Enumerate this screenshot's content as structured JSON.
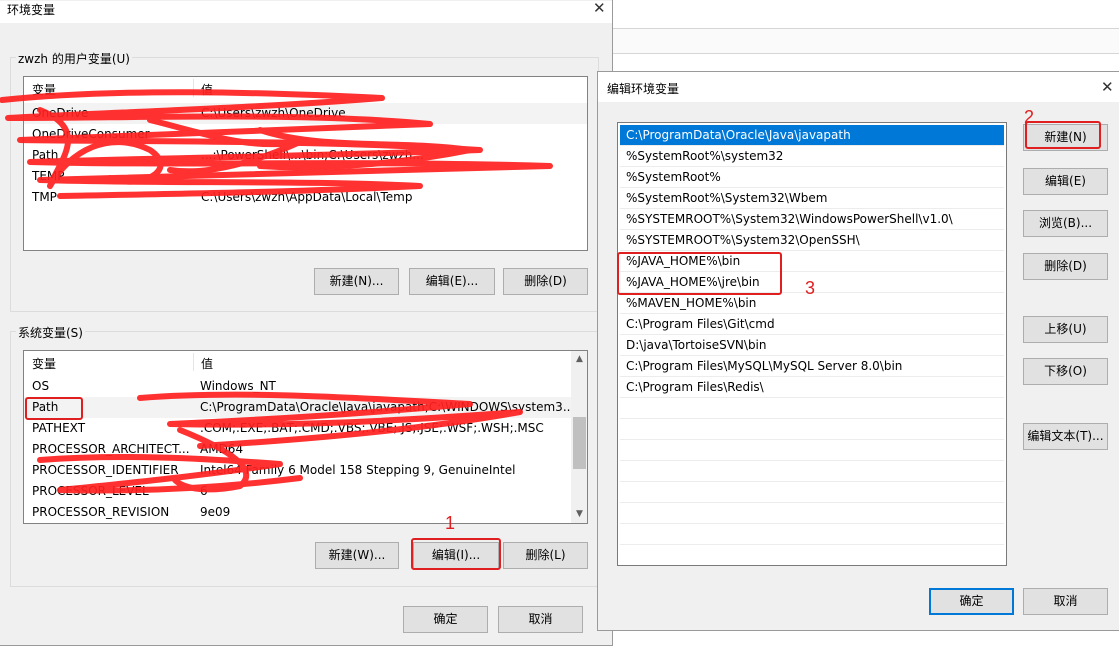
{
  "colors": {
    "accent": "#0078d7",
    "annotation_red": "#e02020",
    "window_bg": "#f0f0f0"
  },
  "env_dialog": {
    "title": "环境变量",
    "user_group_label": "zwzh 的用户变量(U)",
    "columns": {
      "variable": "变量",
      "value": "值"
    },
    "user_rows": [
      {
        "name": "OneDrive",
        "value": "C:\\Users\\zwzh\\OneDrive"
      },
      {
        "name": "OneDriveConsumer",
        "value": ""
      },
      {
        "name": "Path",
        "value": "...:\\PowerShell\\...\\bin;C:\\Users\\zwzh..."
      },
      {
        "name": "TEMP",
        "value": ""
      },
      {
        "name": "TMP",
        "value": "C:\\Users\\zwzh\\AppData\\Local\\Temp"
      }
    ],
    "user_buttons": {
      "new": "新建(N)...",
      "edit": "编辑(E)...",
      "delete": "删除(D)"
    },
    "system_group_label": "系统变量(S)",
    "system_rows": [
      {
        "name": "OS",
        "value": "Windows_NT"
      },
      {
        "name": "Path",
        "value": "C:\\ProgramData\\Oracle\\Java\\javapath;C:\\WINDOWS\\system3..."
      },
      {
        "name": "PATHEXT",
        "value": ".COM;.EXE;.BAT;.CMD;.VBS;.VBE;.JS;.JSE;.WSF;.WSH;.MSC"
      },
      {
        "name": "PROCESSOR_ARCHITECT...",
        "value": "AMD64"
      },
      {
        "name": "PROCESSOR_IDENTIFIER",
        "value": "Intel64 Family 6 Model 158 Stepping 9, GenuineIntel"
      },
      {
        "name": "PROCESSOR_LEVEL",
        "value": "6"
      },
      {
        "name": "PROCESSOR_REVISION",
        "value": "9e09"
      }
    ],
    "system_buttons": {
      "new": "新建(W)...",
      "edit": "编辑(I)...",
      "delete": "删除(L)"
    },
    "ok": "确定",
    "cancel": "取消"
  },
  "edit_dialog": {
    "title": "编辑环境变量",
    "paths": [
      "C:\\ProgramData\\Oracle\\Java\\javapath",
      "%SystemRoot%\\system32",
      "%SystemRoot%",
      "%SystemRoot%\\System32\\Wbem",
      "%SYSTEMROOT%\\System32\\WindowsPowerShell\\v1.0\\",
      "%SYSTEMROOT%\\System32\\OpenSSH\\",
      "%JAVA_HOME%\\bin",
      "%JAVA_HOME%\\jre\\bin",
      "%MAVEN_HOME%\\bin",
      "C:\\Program Files\\Git\\cmd",
      "D:\\java\\TortoiseSVN\\bin",
      "C:\\Program Files\\MySQL\\MySQL Server 8.0\\bin",
      "C:\\Program Files\\Redis\\"
    ],
    "buttons": {
      "new": "新建(N)",
      "edit": "编辑(E)",
      "browse": "浏览(B)...",
      "delete": "删除(D)",
      "move_up": "上移(U)",
      "move_down": "下移(O)",
      "edit_text": "编辑文本(T)...",
      "ok": "确定",
      "cancel": "取消"
    }
  },
  "annotations": {
    "step1": "1",
    "step2": "2",
    "step3": "3"
  },
  "icons": {
    "close": "close-icon",
    "scroll_up": "chevron-up-icon",
    "scroll_down": "chevron-down-icon"
  }
}
